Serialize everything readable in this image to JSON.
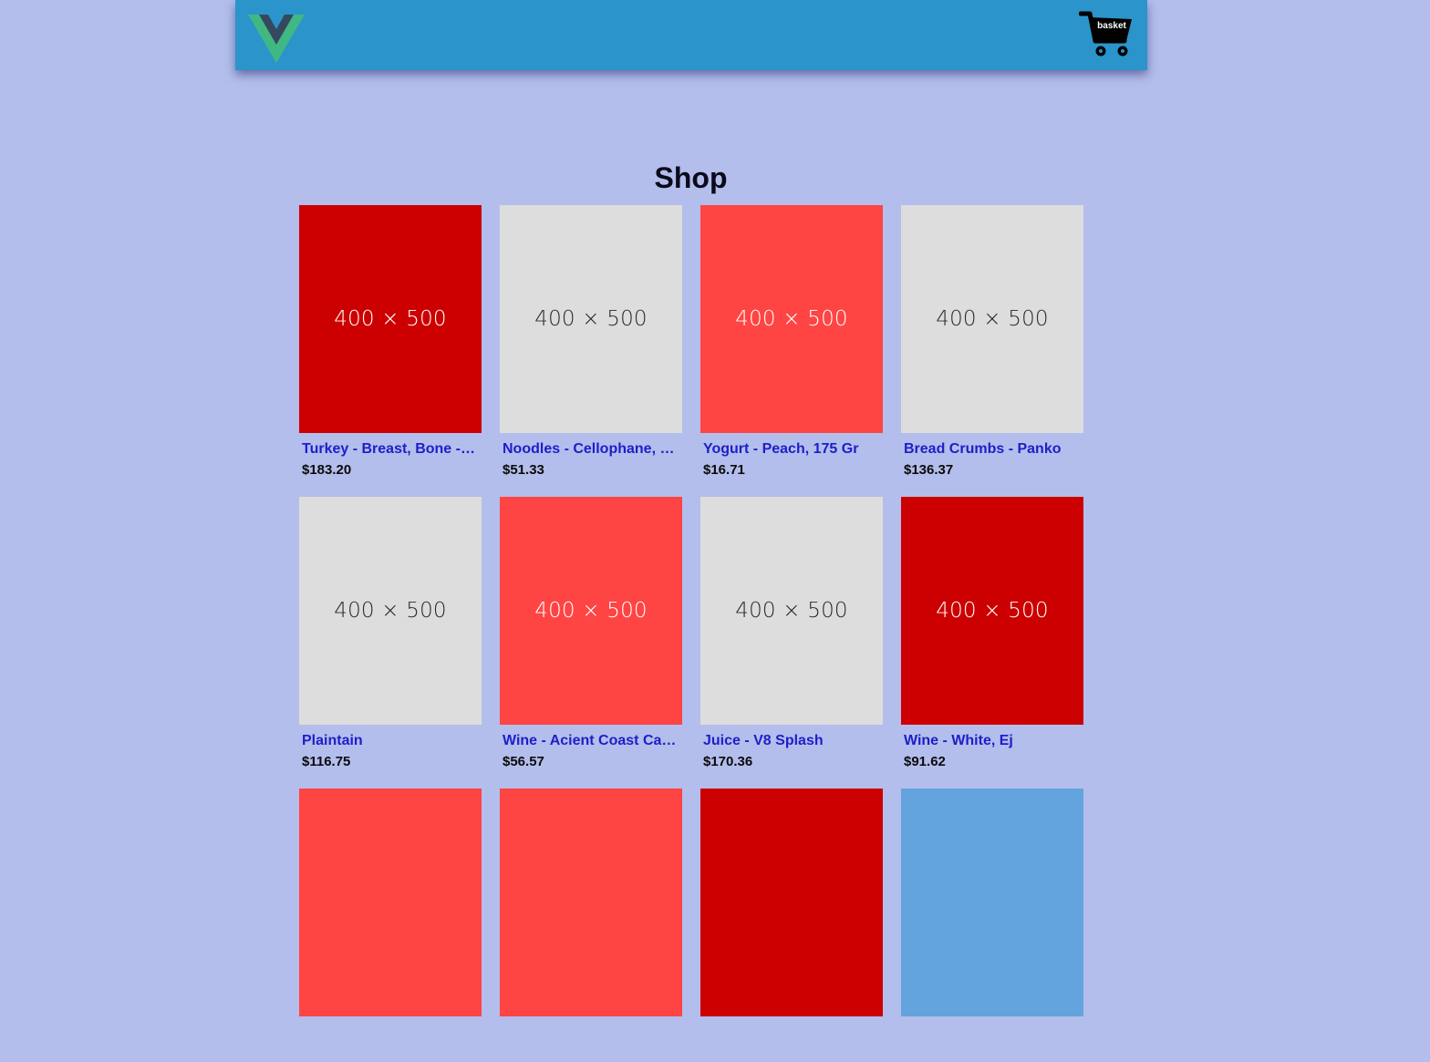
{
  "header": {
    "logo_icon": "vue-logo-icon",
    "basket_icon": "shopping-cart-icon",
    "basket_label": "basket",
    "background_color": "#2a94cb"
  },
  "page": {
    "title": "Shop",
    "background_color": "#b3beec"
  },
  "products": [
    {
      "image_text": "400 × 500",
      "image_color": "#cc0000",
      "name": "Turkey - Breast, Bone - In",
      "price": "$183.20"
    },
    {
      "image_text": "400 × 500",
      "image_color": "#dddddd",
      "name": "Noodles - Cellophane, Thin",
      "price": "$51.33"
    },
    {
      "image_text": "400 × 500",
      "image_color": "#ff4444",
      "name": "Yogurt - Peach, 175 Gr",
      "price": "$16.71"
    },
    {
      "image_text": "400 × 500",
      "image_color": "#dddddd",
      "name": "Bread Crumbs - Panko",
      "price": "$136.37"
    },
    {
      "image_text": "400 × 500",
      "image_color": "#dddddd",
      "name": "Plaintain",
      "price": "$116.75"
    },
    {
      "image_text": "400 × 500",
      "image_color": "#ff4444",
      "name": "Wine - Acient Coast Caberne",
      "price": "$56.57"
    },
    {
      "image_text": "400 × 500",
      "image_color": "#dddddd",
      "name": "Juice - V8 Splash",
      "price": "$170.36"
    },
    {
      "image_text": "400 × 500",
      "image_color": "#cc0000",
      "name": "Wine - White, Ej",
      "price": "$91.62"
    },
    {
      "image_color": "#ff4444"
    },
    {
      "image_color": "#ff4444"
    },
    {
      "image_color": "#cc0000"
    },
    {
      "image_color": "#63a4de"
    }
  ]
}
